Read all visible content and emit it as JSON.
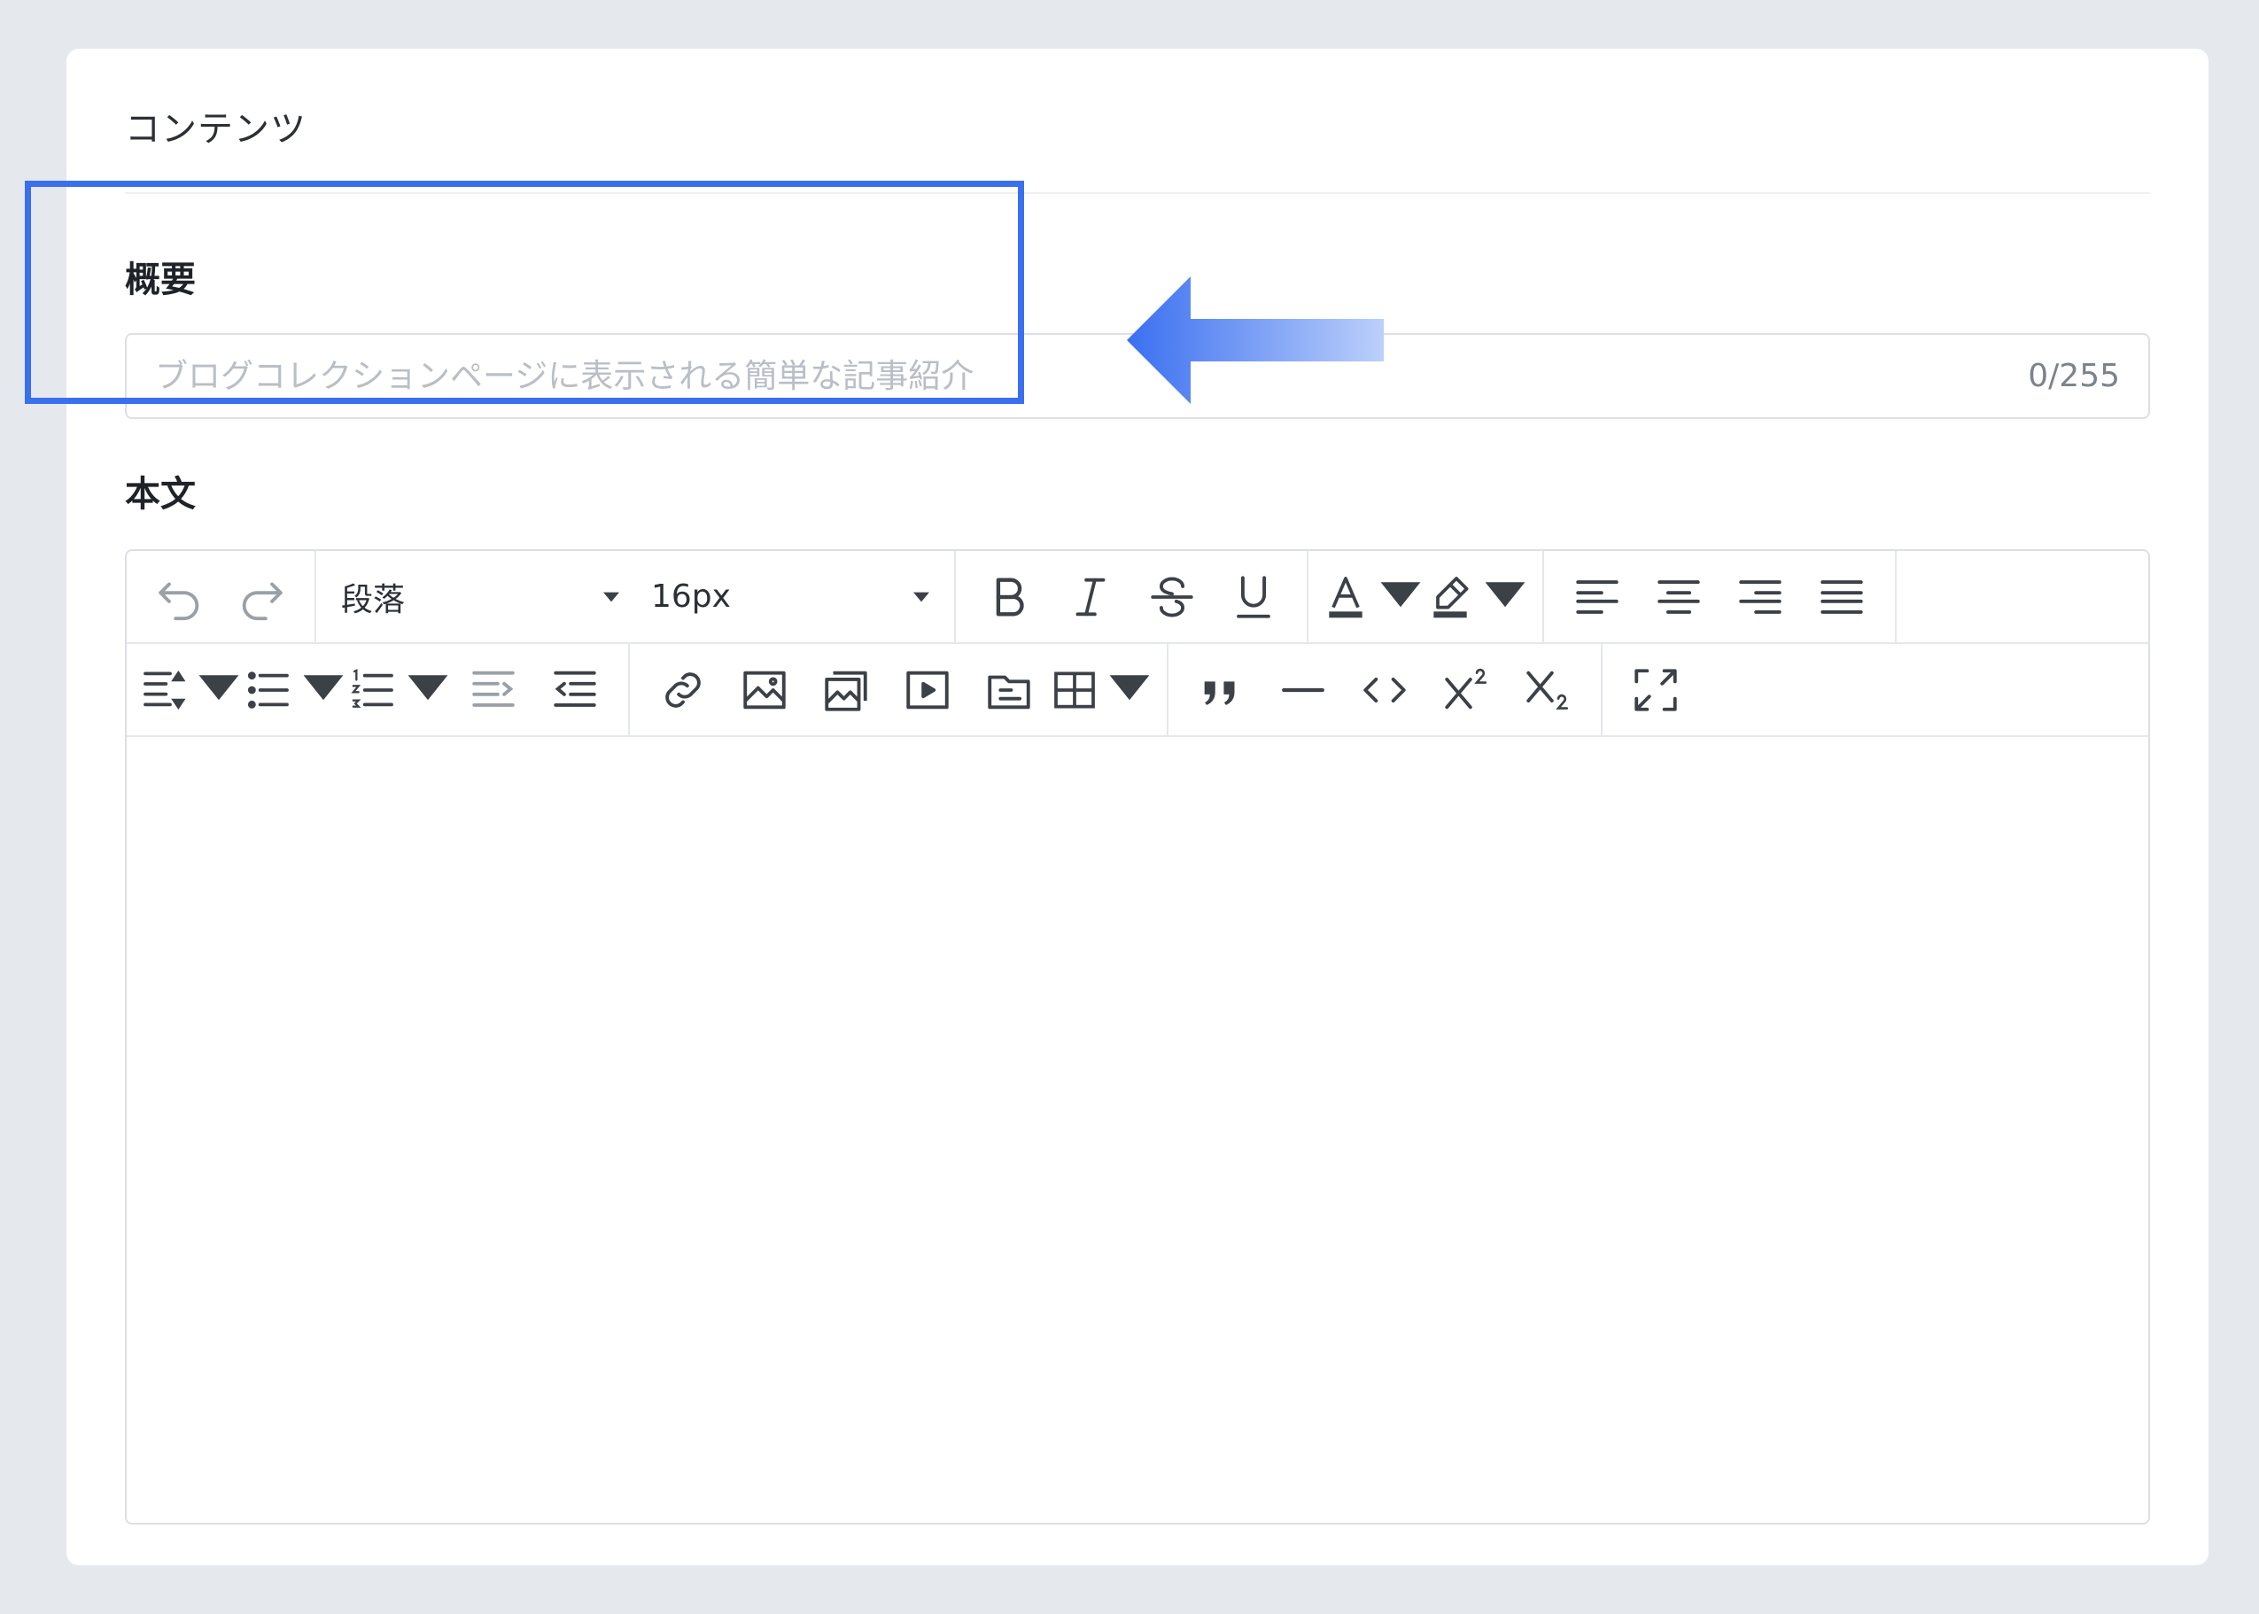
{
  "section": {
    "title": "コンテンツ"
  },
  "summary": {
    "label": "概要",
    "placeholder": "ブログコレクションページに表示される簡単な記事紹介",
    "value": "",
    "counter": "0/255"
  },
  "body": {
    "label": "本文",
    "block_format": "段落",
    "font_size": "16px",
    "content": ""
  },
  "annotation": {
    "box_color": "#3a6ff0",
    "arrow_color": "#3a6ff0"
  },
  "toolbar_icons": [
    "undo-icon",
    "redo-icon",
    "bold-icon",
    "italic-icon",
    "strikethrough-icon",
    "underline-icon",
    "text-color-icon",
    "highlight-color-icon",
    "align-left-icon",
    "align-center-icon",
    "align-right-icon",
    "align-justify-icon",
    "line-height-icon",
    "bullet-list-icon",
    "numbered-list-icon",
    "outdent-icon",
    "indent-icon",
    "link-icon",
    "image-icon",
    "gallery-icon",
    "video-icon",
    "file-icon",
    "table-icon",
    "blockquote-icon",
    "horizontal-rule-icon",
    "code-icon",
    "superscript-icon",
    "subscript-icon",
    "fullscreen-icon"
  ]
}
